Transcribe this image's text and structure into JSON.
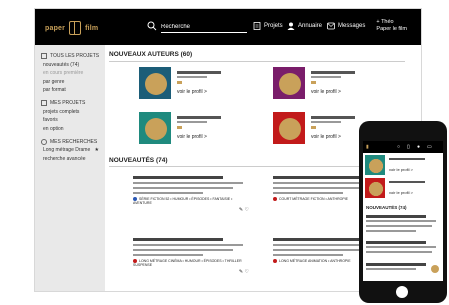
{
  "brand": {
    "left": "paper",
    "right": "film"
  },
  "search": {
    "placeholder": "Recherche"
  },
  "nav": {
    "projets": "Projets",
    "annuaire": "Annuaire",
    "messages": "Messages",
    "user_name": "+ Théo",
    "user_sub": "Paper le film"
  },
  "sidebar": {
    "group1": "TOUS LES PROJETS",
    "items1": [
      "nouveautés (74)",
      "en cours première",
      "par genre",
      "par format"
    ],
    "group2": "MES PROJETS",
    "items2": [
      "projets complets",
      "favoris",
      "en option"
    ],
    "group3": "MES RECHERCHES",
    "items3": [
      "Long métrage Drame",
      "recherche avancée"
    ],
    "star": "★"
  },
  "main": {
    "authors_title": "NOUVEAUX AUTEURS (60)",
    "news_title": "NOUVEAUTÉS (74)",
    "see_profile": "voir le profil >",
    "authors": [
      {
        "bg": "#1c5d78",
        "circle": "#c9a15a"
      },
      {
        "bg": "#7a1d6a",
        "circle": "#c9a15a"
      },
      {
        "bg": "#1f8a7e",
        "circle": "#c9a15a"
      },
      {
        "bg": "#c21a1a",
        "circle": "#c9a15a"
      }
    ],
    "news": [
      {
        "meta": "SÉRIE FICTION 52 • HUMOUR • ÉPISODES • FANTAISIE • AVENTURE",
        "color": "#2a58b5"
      },
      {
        "meta": "COURT MÉTRAGE FICTION • ANTHROPIE",
        "color": "#c21a1a"
      },
      {
        "meta": "LONG MÉTRAGE CINÉMA • HUMOUR • ÉPISODES • THRILLER SUSPENSE",
        "color": "#c21a1a"
      },
      {
        "meta": "LONG MÉTRAGE ANIMATION • ANTHROPIE",
        "color": "#c21a1a"
      }
    ]
  },
  "phone": {
    "see_profile": "voir le profil >",
    "news_title": "NOUVEAUTÉS (74)",
    "cards": [
      {
        "bg": "#1f8a7e",
        "circle": "#c9a15a"
      },
      {
        "bg": "#c21a1a",
        "circle": "#c9a15a"
      }
    ]
  },
  "colors": {
    "accent": "#c9a15a",
    "topbar": "#000000"
  }
}
